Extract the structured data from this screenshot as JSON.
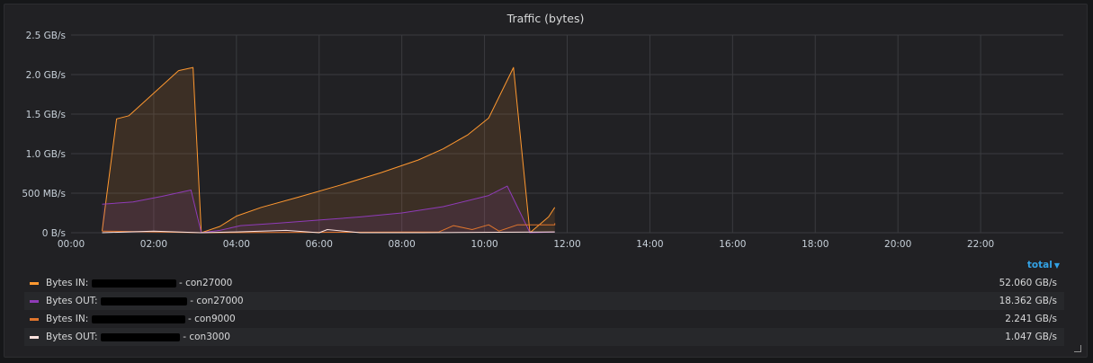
{
  "panel": {
    "title": "Traffic (bytes)"
  },
  "chart_data": {
    "type": "area",
    "title": "Traffic (bytes)",
    "y_unit": "GB/s",
    "ylim": [
      0,
      2.5
    ],
    "y_ticks": [
      {
        "v": 0,
        "label": "0 B/s"
      },
      {
        "v": 0.5,
        "label": "500 MB/s"
      },
      {
        "v": 1.0,
        "label": "1.0 GB/s"
      },
      {
        "v": 1.5,
        "label": "1.5 GB/s"
      },
      {
        "v": 2.0,
        "label": "2.0 GB/s"
      },
      {
        "v": 2.5,
        "label": "2.5 GB/s"
      }
    ],
    "x_unit": "hours",
    "xlim": [
      0,
      24
    ],
    "x_ticks": [
      {
        "v": 0,
        "label": "00:00"
      },
      {
        "v": 2,
        "label": "02:00"
      },
      {
        "v": 4,
        "label": "04:00"
      },
      {
        "v": 6,
        "label": "06:00"
      },
      {
        "v": 8,
        "label": "08:00"
      },
      {
        "v": 10,
        "label": "10:00"
      },
      {
        "v": 12,
        "label": "12:00"
      },
      {
        "v": 14,
        "label": "14:00"
      },
      {
        "v": 16,
        "label": "16:00"
      },
      {
        "v": 18,
        "label": "18:00"
      },
      {
        "v": 20,
        "label": "20:00"
      },
      {
        "v": 22,
        "label": "22:00"
      }
    ],
    "grid": true,
    "series": [
      {
        "color": "#ff9830",
        "fill": true,
        "points": [
          [
            0.75,
            0.02
          ],
          [
            1.1,
            1.44
          ],
          [
            1.4,
            1.48
          ],
          [
            2.6,
            2.05
          ],
          [
            2.95,
            2.09
          ],
          [
            3.15,
            0.0
          ],
          [
            3.6,
            0.08
          ],
          [
            4.0,
            0.21
          ],
          [
            4.6,
            0.32
          ],
          [
            5.5,
            0.45
          ],
          [
            6.5,
            0.6
          ],
          [
            7.5,
            0.76
          ],
          [
            8.4,
            0.92
          ],
          [
            9.0,
            1.06
          ],
          [
            9.6,
            1.24
          ],
          [
            10.1,
            1.45
          ],
          [
            10.7,
            2.09
          ],
          [
            11.1,
            0.0
          ],
          [
            11.55,
            0.2
          ],
          [
            11.7,
            0.32
          ]
        ]
      },
      {
        "color": "#8f3bb8",
        "fill": true,
        "points": [
          [
            0.75,
            0.36
          ],
          [
            1.5,
            0.39
          ],
          [
            2.2,
            0.46
          ],
          [
            2.9,
            0.54
          ],
          [
            3.15,
            0.0
          ],
          [
            3.6,
            0.03
          ],
          [
            4.1,
            0.09
          ],
          [
            5.0,
            0.12
          ],
          [
            6.0,
            0.16
          ],
          [
            7.0,
            0.2
          ],
          [
            8.0,
            0.25
          ],
          [
            9.0,
            0.33
          ],
          [
            10.1,
            0.47
          ],
          [
            10.55,
            0.59
          ],
          [
            11.1,
            0.0
          ],
          [
            11.7,
            0.01
          ]
        ]
      },
      {
        "color": "#e0752d",
        "fill": false,
        "points": [
          [
            0.75,
            0.02
          ],
          [
            3.15,
            0.0
          ],
          [
            8.9,
            0.01
          ],
          [
            9.25,
            0.09
          ],
          [
            9.7,
            0.04
          ],
          [
            10.1,
            0.1
          ],
          [
            10.35,
            0.02
          ],
          [
            10.8,
            0.1
          ],
          [
            11.7,
            0.1
          ],
          [
            11.7,
            0.12
          ]
        ]
      },
      {
        "color": "#fce2de",
        "fill": false,
        "points": [
          [
            0.75,
            0.0
          ],
          [
            2.0,
            0.02
          ],
          [
            3.15,
            0.0
          ],
          [
            4.0,
            0.01
          ],
          [
            5.2,
            0.03
          ],
          [
            6.0,
            0.0
          ],
          [
            6.2,
            0.04
          ],
          [
            7.0,
            0.0
          ],
          [
            8.5,
            0.0
          ],
          [
            11.7,
            0.01
          ]
        ]
      }
    ]
  },
  "legend": {
    "header": "total",
    "items": [
      {
        "color": "#ff9830",
        "prefix": "Bytes IN: ",
        "suffix": " - con27000",
        "total": "52.060 GB/s"
      },
      {
        "color": "#8f3bb8",
        "prefix": "Bytes OUT: ",
        "suffix": " - con27000",
        "total": "18.362 GB/s"
      },
      {
        "color": "#e0752d",
        "prefix": "Bytes IN: ",
        "suffix": " - con9000",
        "total": "2.241 GB/s"
      },
      {
        "color": "#fce2de",
        "prefix": "Bytes OUT: ",
        "suffix": " - con3000",
        "total": "1.047 GB/s"
      }
    ]
  }
}
